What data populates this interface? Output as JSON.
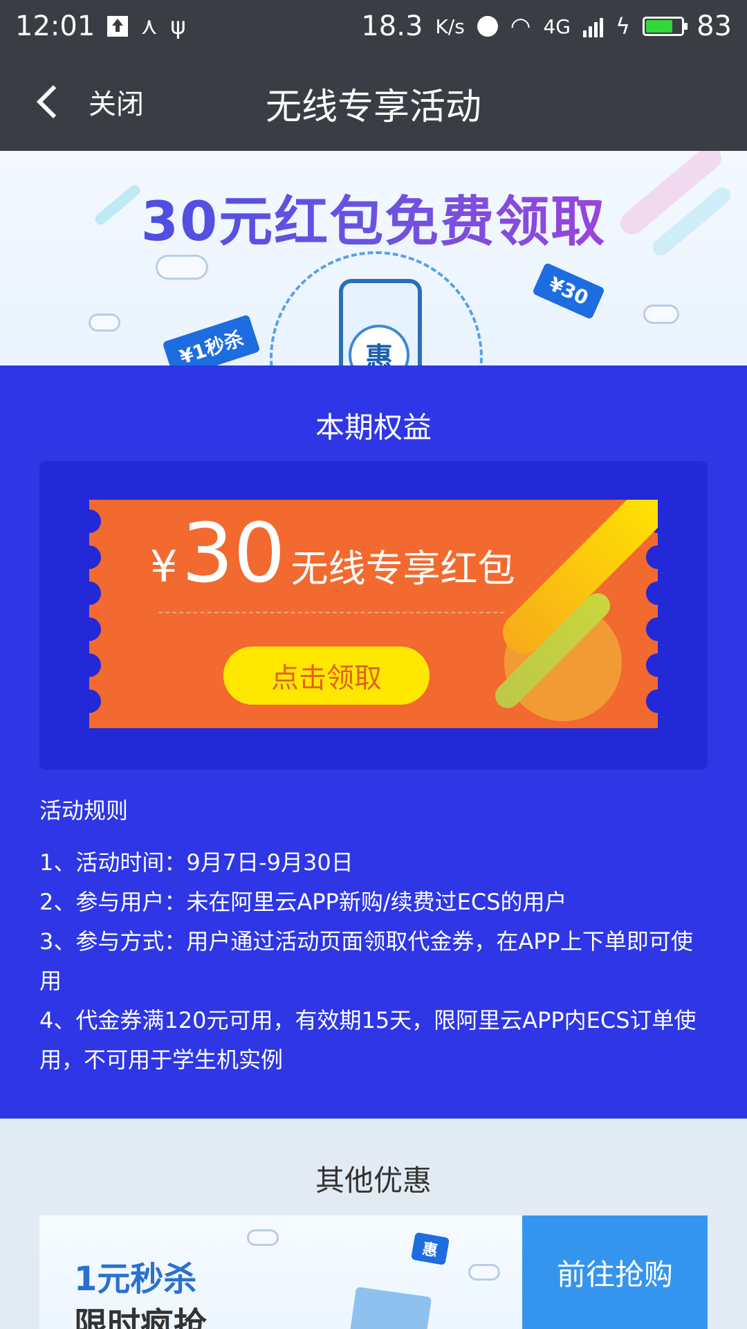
{
  "status_bar": {
    "time": "12:01",
    "speed": "18.3",
    "speed_unit": "K/s",
    "network": "4G",
    "battery": "83",
    "battery_level_percent": 83,
    "icons": [
      "upload-icon",
      "share-icon",
      "usb-icon",
      "alarm-icon",
      "wifi-icon",
      "signal-icon",
      "charging-icon",
      "battery-icon"
    ]
  },
  "nav": {
    "back_label": "关闭",
    "title": "无线专享活动"
  },
  "hero": {
    "title": "30元红包免费领取",
    "phone_badge": "惠",
    "tag_left": "¥1秒杀",
    "tag_right": "¥30"
  },
  "benefits": {
    "section_title": "本期权益",
    "coupon": {
      "currency": "¥",
      "amount": "30",
      "label": "无线专享红包",
      "claim_button": "点击领取"
    },
    "rules_title": "活动规则",
    "rules": [
      "1、活动时间：9月7日-9月30日",
      "2、参与用户：未在阿里云APP新购/续费过ECS的用户",
      "3、参与方式：用户通过活动页面领取代金券，在APP上下单即可使用",
      "4、代金券满120元可用，有效期15天，限阿里云APP内ECS订单使用，不可用于学生机实例"
    ]
  },
  "other": {
    "section_title": "其他优惠",
    "offer_line1": "1元秒杀",
    "offer_line2": "限时疯抢",
    "offer_badge": "惠",
    "offer_button": "前往抢购"
  },
  "colors": {
    "nav_bg": "#3a3d43",
    "main_bg": "#2e36e6",
    "coupon": "#f26a2f",
    "claim_button": "#ffe800",
    "offer_button": "#3595ee"
  }
}
